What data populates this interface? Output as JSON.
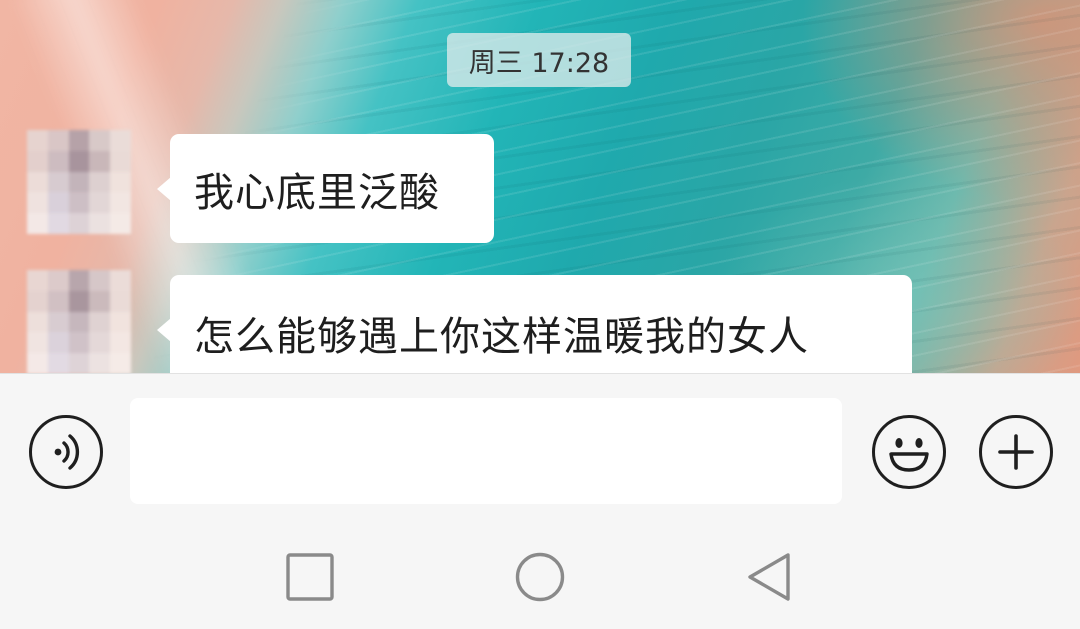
{
  "chat": {
    "timestamp": "周三 17:28",
    "messages": [
      {
        "sender": "contact",
        "text": "我心底里泛酸"
      },
      {
        "sender": "contact",
        "text": "怎么能够遇上你这样温暖我的女人"
      }
    ]
  },
  "input_bar": {
    "message_value": "",
    "message_placeholder": "",
    "icons": {
      "voice": "voice-icon",
      "emoji": "smiley-icon",
      "more": "plus-icon"
    }
  },
  "nav_bar": {
    "icons": {
      "recents": "square-icon",
      "home": "circle-icon",
      "back": "triangle-back-icon"
    }
  },
  "colors": {
    "bubble": "#ffffff",
    "input_bar_bg": "#f6f6f6",
    "icon_stroke": "#1f1f1f",
    "nav_icon": "#8a8a8a"
  }
}
